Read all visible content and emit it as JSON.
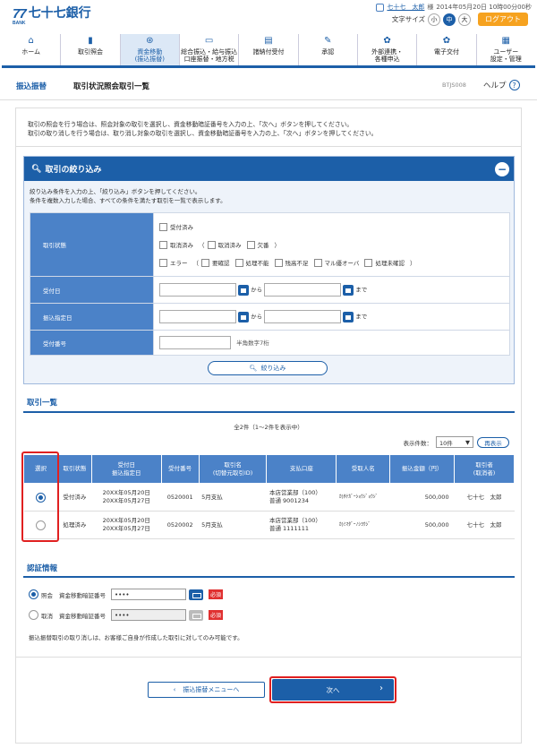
{
  "header": {
    "logo_mark": "77",
    "logo_sub": "BANK",
    "logo_name": "七十七銀行",
    "user_name": "七十七　太郎",
    "user_suffix": "様",
    "login_time": "2014年05月20日 10時00分00秒",
    "font_size_label": "文字サイズ",
    "font_small": "小",
    "font_medium": "中",
    "font_large": "大",
    "logout": "ログアウト"
  },
  "nav": [
    {
      "label": "ホーム",
      "icon": "home-icon"
    },
    {
      "label": "取引照会",
      "icon": "book-icon"
    },
    {
      "label": "資金移動\n(振込振替)",
      "icon": "transfer-icon",
      "active": true
    },
    {
      "label": "総合振込・給与振込\n口座振替・地方税",
      "icon": "batch-icon"
    },
    {
      "label": "諸納付受付",
      "icon": "payment-icon"
    },
    {
      "label": "承認",
      "icon": "approve-icon"
    },
    {
      "label": "外部連携・\n各種申込",
      "icon": "link-icon"
    },
    {
      "label": "電子交付",
      "icon": "document-icon"
    },
    {
      "label": "ユーザー\n設定・管理",
      "icon": "user-settings-icon"
    }
  ],
  "section": {
    "category": "振込振替",
    "title": "取引状況照会取引一覧",
    "code": "BTJS008",
    "help": "ヘルプ"
  },
  "instructions": [
    "取引の照会を行う場合は、照会対象の取引を選択し、資金移動暗証番号を入力の上、「次へ」ボタンを押してください。",
    "取引の取り消しを行う場合は、取り消し対象の取引を選択し、資金移動暗証番号を入力の上、「次へ」ボタンを押してください。"
  ],
  "filter": {
    "title": "取引の絞り込み",
    "instructions": [
      "絞り込み条件を入力の上、「絞り込み」ボタンを押してください。",
      "条件を複数入力した場合、すべての条件を満たす取引を一覧で表示します。"
    ],
    "status_label": "取引状態",
    "status": {
      "accepted": "受付済み",
      "cancelled": "取消済み",
      "paren_open": "（",
      "cancel_done": "取消済み",
      "missing": "欠番",
      "paren_close": "）",
      "error": "エラー",
      "paren2_open": "（",
      "needs_check": "要確認",
      "cannot_process": "処理不能",
      "over_limit": "残高不足",
      "multi_over": "マル優オーバ",
      "unconfirmed": "処理未確認",
      "paren2_close": "）"
    },
    "accept_date_label": "受付日",
    "transfer_date_label": "振込指定日",
    "from": "から",
    "to": "まで",
    "accept_no_label": "受付番号",
    "accept_no_hint": "半角数字7桁",
    "button": "絞り込み"
  },
  "list": {
    "title": "取引一覧",
    "count": "全2件（1～2件を表示中）",
    "page_size_label": "表示件数：",
    "page_size": "10件",
    "redisplay": "再表示",
    "columns": [
      "選択",
      "取引状態",
      "受付日\n振込指定日",
      "受付番号",
      "取引名\n(切替元取引ID)",
      "支払口座",
      "受取人名",
      "振込金額（円）",
      "取引者\n(取消者)"
    ],
    "rows": [
      {
        "selected": true,
        "status": "受付済み",
        "accept_date": "20XX年05月20日",
        "transfer_date": "20XX年05月27日",
        "number": "0520001",
        "name": "5月支払",
        "account_branch": "本店営業部（100）",
        "account_no": "普通 9001234",
        "payee": "ｶ)ﾀﾅｶﾞｰｼｮｳｼﾞｮｳｼﾞ",
        "amount": "500,000",
        "operator": "七十七　太郎"
      },
      {
        "selected": false,
        "status": "処理済み",
        "accept_date": "20XX年05月20日",
        "transfer_date": "20XX年05月27日",
        "number": "0520002",
        "name": "5月支払",
        "account_branch": "本店営業部（100）",
        "account_no": "普通 1111111",
        "payee": "ｶ)ﾐﾏﾀﾞｰﾉｼﾖｳｼﾞ",
        "amount": "500,000",
        "operator": "七十七　太郎"
      }
    ]
  },
  "auth": {
    "title": "認証情報",
    "rows": [
      {
        "mode": "照会",
        "label": "資金移動暗証番号",
        "value": "••••",
        "required": "必須",
        "selected": true
      },
      {
        "mode": "取消",
        "label": "資金移動暗証番号",
        "value": "••••",
        "required": "必須",
        "selected": false
      }
    ],
    "note": "振込振替取引の取り消しは、お客様ご自身が作成した取引に対してのみ可能です。"
  },
  "footer": {
    "back": "振込振替メニューへ",
    "next": "次へ"
  }
}
